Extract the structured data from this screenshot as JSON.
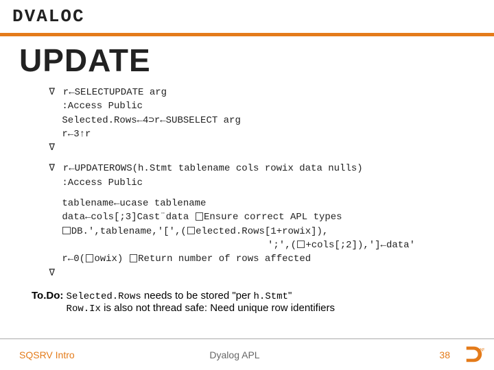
{
  "brand": "DVALOC",
  "title": "UPDATE",
  "code1": {
    "del_open": "∇",
    "l1": " r←SELECTUPDATE arg",
    "l2": ":Access Public",
    "l3": "Selected.Rows←4⊃r←SUBSELECT arg",
    "l4": "r←3↑r",
    "del_close": "∇"
  },
  "code2": {
    "del_open": "∇",
    "l1": " r←UPDATEROWS(h.Stmt tablename cols rowix data nulls)",
    "l2": ":Access Public"
  },
  "code3": {
    "l1": "tablename←ucase tablename",
    "l2a": "data←cols[;3]Cast¨data ",
    "l2b": "Ensure correct APL types",
    "l3a": "DB.',tablename,'[',(",
    "l3b": "elected.Rows[1+rowix]),",
    "l4a": "';',(",
    "l4b": "+cols[;2]),']←data'",
    "l5a": "r←0(",
    "l5b": "owix) ",
    "l5c": "Return number of rows affected",
    "del_close": "∇"
  },
  "todo": {
    "label": "To.Do:",
    "line1_a": "Selected.Rows",
    "line1_b": " needs to be stored \"per ",
    "line1_c": "h.Stmt",
    "line1_d": "\"",
    "line2_a": "Row.Ix",
    "line2_b": " is also not thread safe: Need unique row identifiers"
  },
  "footer": {
    "left": "SQSRV Intro",
    "center": "Dyalog APL",
    "page": "38"
  }
}
